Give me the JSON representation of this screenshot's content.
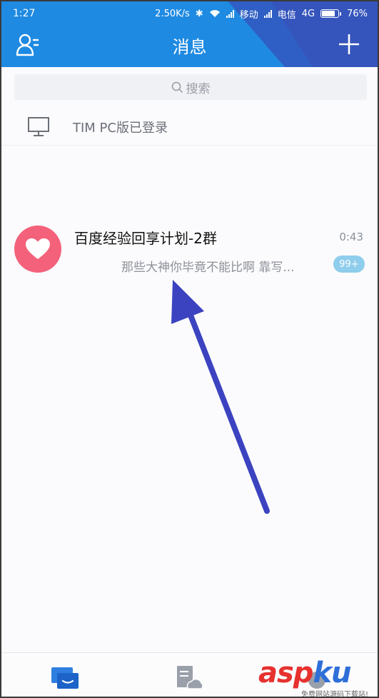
{
  "status_bar": {
    "time": "1:27",
    "speed": "2.50K/s",
    "carrier1": "移动",
    "carrier2": "电信",
    "network": "4G",
    "battery": "76%",
    "battery_level": 0.76
  },
  "header": {
    "title": "消息",
    "color": "#1f8ae2"
  },
  "search": {
    "placeholder": "搜索"
  },
  "pc_login": {
    "label": "TIM PC版已登录"
  },
  "conversations": [
    {
      "name": "百度经验回享计划-2群",
      "time": "0:43",
      "preview": "那些大神你毕竟不能比啊 靠写...",
      "badge": "99+",
      "avatar_color": "#f4617a"
    }
  ],
  "tabs": [
    {
      "icon": "chat-bubble-icon",
      "active": true
    },
    {
      "icon": "document-cloud-icon",
      "active": false
    },
    {
      "icon": "more-icon",
      "active": false
    }
  ],
  "watermark": {
    "brand_a": "asp",
    "brand_k": "ku",
    "sub": "免费网站源码下载站!"
  }
}
